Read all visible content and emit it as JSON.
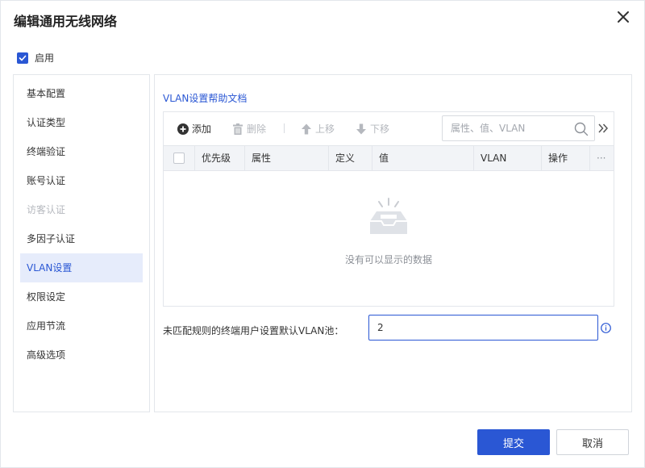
{
  "dialog": {
    "title": "编辑通用无线网络",
    "enable_label": "启用"
  },
  "sidebar": {
    "items": [
      {
        "label": "基本配置",
        "state": "normal"
      },
      {
        "label": "认证类型",
        "state": "normal"
      },
      {
        "label": "终端验证",
        "state": "normal"
      },
      {
        "label": "账号认证",
        "state": "normal"
      },
      {
        "label": "访客认证",
        "state": "disabled"
      },
      {
        "label": "多因子认证",
        "state": "normal"
      },
      {
        "label": "VLAN设置",
        "state": "active"
      },
      {
        "label": "权限设定",
        "state": "normal"
      },
      {
        "label": "应用节流",
        "state": "normal"
      },
      {
        "label": "高级选项",
        "state": "normal"
      }
    ]
  },
  "main": {
    "help_link": "VLAN设置帮助文档",
    "toolbar": {
      "add": "添加",
      "delete": "删除",
      "move_up": "上移",
      "move_down": "下移",
      "search_placeholder": "属性、值、VLAN"
    },
    "table": {
      "columns": [
        "优先级",
        "属性",
        "定义",
        "值",
        "VLAN",
        "操作"
      ],
      "more": "···",
      "empty_text": "没有可以显示的数据"
    },
    "default_vlan": {
      "label": "未匹配规则的终端用户设置默认VLAN池：",
      "value": "2"
    }
  },
  "footer": {
    "submit": "提交",
    "cancel": "取消"
  },
  "colors": {
    "accent": "#2a57d4",
    "active_bg": "#e6ecfb",
    "disabled_text": "#b5b8be",
    "header_bg": "#f2f4f7"
  },
  "icons": [
    "close-icon",
    "check-icon",
    "plus-circle-icon",
    "trash-icon",
    "arrow-up-icon",
    "arrow-down-icon",
    "search-icon",
    "double-chevron-right-icon",
    "empty-box-icon",
    "info-icon"
  ]
}
